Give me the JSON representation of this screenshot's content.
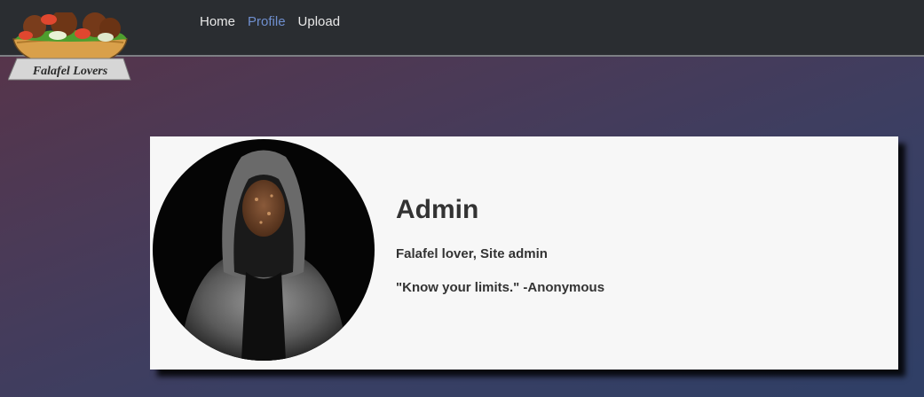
{
  "brand": {
    "logo_text": "Falafel Lovers"
  },
  "nav": {
    "items": [
      {
        "label": "Home"
      },
      {
        "label": "Profile",
        "active": true
      },
      {
        "label": "Upload"
      }
    ]
  },
  "profile": {
    "name": "Admin",
    "role": "Falafel lover, Site admin",
    "quote": "\"Know your limits.\" -Anonymous"
  },
  "colors": {
    "navbar": "#2a2d31",
    "active_link": "#6f8fcf",
    "card": "#f7f7f7",
    "text": "#333333"
  }
}
